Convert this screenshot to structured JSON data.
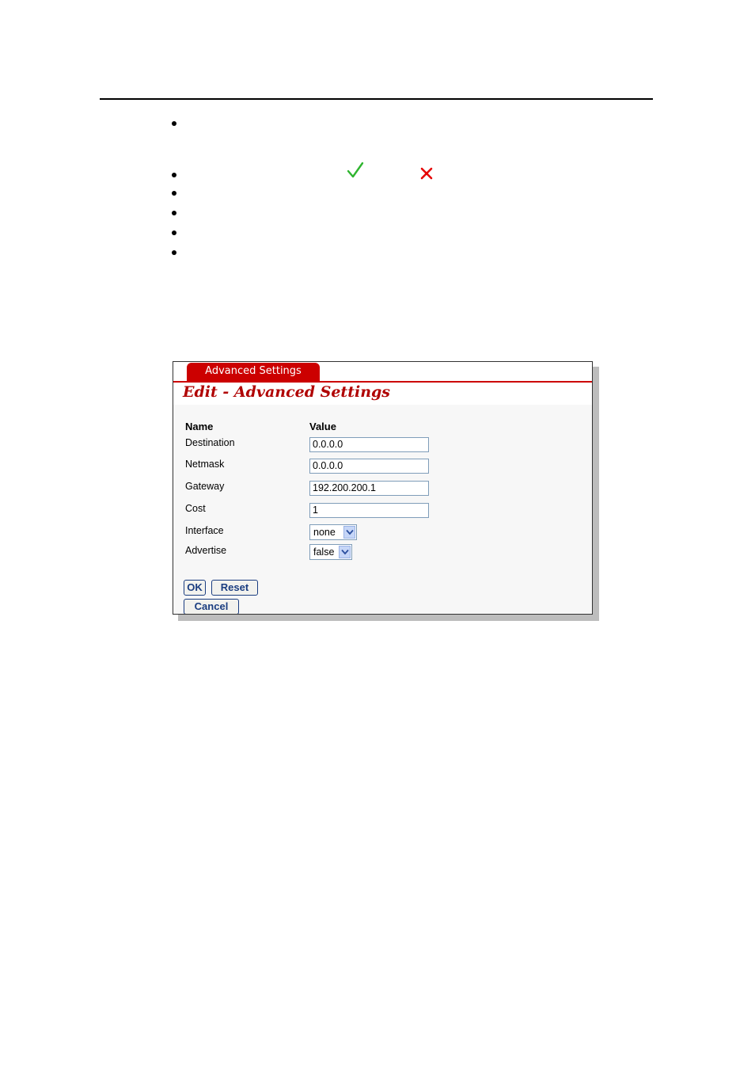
{
  "panel": {
    "tab_label": "Advanced Settings",
    "title": "Edit - Advanced Settings",
    "headers": {
      "name": "Name",
      "value": "Value"
    },
    "fields": [
      {
        "label": "Destination",
        "value": "0.0.0.0"
      },
      {
        "label": "Netmask",
        "value": "0.0.0.0"
      },
      {
        "label": "Gateway",
        "value": "192.200.200.1"
      },
      {
        "label": "Cost",
        "value": "1"
      }
    ],
    "selects": [
      {
        "label": "Interface",
        "value": "none"
      },
      {
        "label": "Advertise",
        "value": "false"
      }
    ],
    "buttons": {
      "ok": "OK",
      "reset": "Reset",
      "cancel": "Cancel"
    }
  },
  "icons": {
    "check": "checkmark-icon",
    "cross": "x-icon"
  },
  "colors": {
    "accent": "#cc0000",
    "button_text": "#1a3d80",
    "check": "#2fb52f",
    "cross": "#e60000"
  }
}
